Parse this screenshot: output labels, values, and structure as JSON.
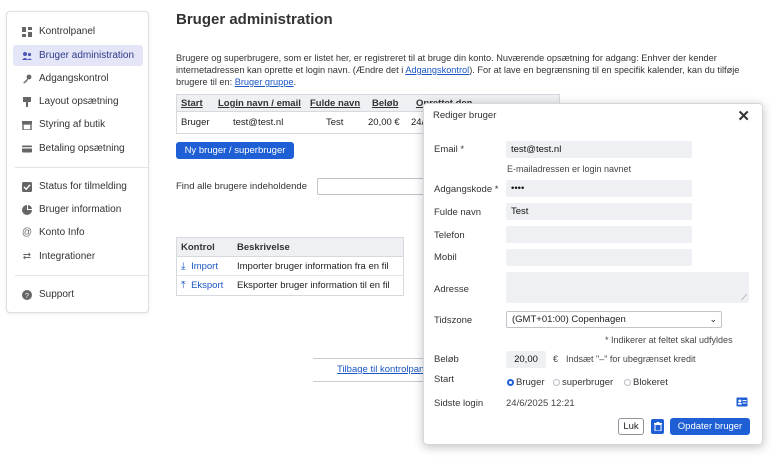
{
  "sidebar": {
    "items": [
      {
        "label": "Kontrolpanel",
        "icon": "dashboard-icon"
      },
      {
        "label": "Bruger administration",
        "icon": "users-icon"
      },
      {
        "label": "Adgangskontrol",
        "icon": "key-icon"
      },
      {
        "label": "Layout opsætning",
        "icon": "paintbrush-icon"
      },
      {
        "label": "Styring af butik",
        "icon": "shop-icon"
      },
      {
        "label": "Betaling opsætning",
        "icon": "credit-card-icon"
      },
      {
        "label": "Status for tilmelding",
        "icon": "checkbox-icon"
      },
      {
        "label": "Bruger information",
        "icon": "pie-chart-icon"
      },
      {
        "label": "Konto Info",
        "icon": "at-icon"
      },
      {
        "label": "Integrationer",
        "icon": "arrows-icon"
      },
      {
        "label": "Support",
        "icon": "help-icon"
      }
    ]
  },
  "main": {
    "title": "Bruger administration",
    "intro_text": "Brugere og superbrugere, som er listet her, er registreret til at bruge din konto. Nuværende opsætning for adgang: Enhver der kender internetadressen kan oprette et login navn. (Ændre det i ",
    "intro_link1": "Adgangskontrol",
    "intro_text2": "). For at lave en begrænsning til en specifik kalender, kan du tilføje brugere til en: ",
    "intro_link2": "Bruger gruppe",
    "intro_text3": ".",
    "users_table": {
      "headers": [
        "Start",
        "Login navn / email",
        "Fulde navn",
        "Beløb",
        "Oprettet den"
      ],
      "rows": [
        [
          "Bruger",
          "test@test.nl",
          "Test",
          "20,00 €",
          "24/"
        ]
      ]
    },
    "new_user_button": "Ny bruger / superbruger",
    "find_label": "Find alle brugere indeholdende",
    "control_table": {
      "headers": [
        "Kontrol",
        "Beskrivelse"
      ],
      "rows": [
        {
          "action": "Import",
          "description": "Importer bruger information fra en fil",
          "icon": "download-icon"
        },
        {
          "action": "Eksport",
          "description": "Eksporter bruger information til en fil",
          "icon": "upload-icon"
        }
      ]
    },
    "back_link": "Tilbage til kontrolpanel"
  },
  "modal": {
    "title": "Rediger bruger",
    "email_label": "Email *",
    "email_value": "test@test.nl",
    "email_hint": "E-mailadressen er login navnet",
    "password_label": "Adgangskode *",
    "password_value": "••••",
    "fullname_label": "Fulde navn",
    "fullname_value": "Test",
    "phone_label": "Telefon",
    "phone_value": "",
    "mobile_label": "Mobil",
    "mobile_value": "",
    "address_label": "Adresse",
    "timezone_label": "Tidszone",
    "timezone_value": "(GMT+01:00) Copenhagen",
    "required_hint": "* Indikerer at feltet skal udfyldes",
    "amount_label": "Beløb",
    "amount_value": "20,00",
    "currency": "€",
    "amount_hint": "Indsæt \"–\" for ubegrænset kredit",
    "start_label": "Start",
    "start_options": [
      "Bruger",
      "superbruger",
      "Blokeret"
    ],
    "start_selected": "Bruger",
    "last_login_label": "Sidste login",
    "last_login_value": "24/6/2025 12:21",
    "close_button": "Luk",
    "update_button": "Opdater bruger"
  },
  "colors": {
    "accent": "#1f5fd6",
    "active_nav": "#e4e6f7",
    "link": "#1a56c4"
  }
}
